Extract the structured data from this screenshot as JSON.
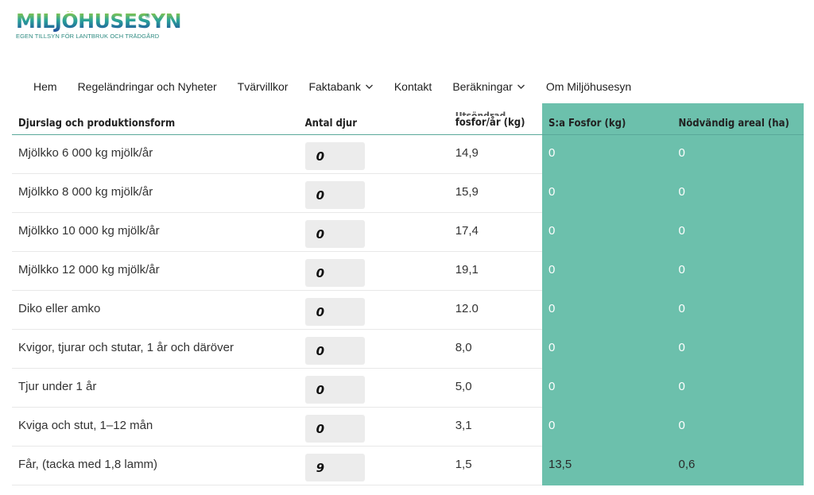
{
  "logo": {
    "title": "MILJÖHUSESYN",
    "reg": "®",
    "subtitle": "EGEN TILLSYN FÖR LANTBRUK OCH TRÄDGÅRD"
  },
  "nav": {
    "items": [
      {
        "label": "Hem",
        "dropdown": false
      },
      {
        "label": "Regeländringar och Nyheter",
        "dropdown": false
      },
      {
        "label": "Tvärvillkor",
        "dropdown": false
      },
      {
        "label": "Faktabank",
        "dropdown": true
      },
      {
        "label": "Kontakt",
        "dropdown": false
      },
      {
        "label": "Beräkningar",
        "dropdown": true
      },
      {
        "label": "Om Miljöhusesyn",
        "dropdown": false
      }
    ]
  },
  "table": {
    "headers": {
      "species": "Djurslag och produktionsform",
      "count": "Antal djur",
      "phosphorus_top": "Utsöndrad",
      "phosphorus": "fosfor/år (kg)",
      "total": "S:a Fosfor (kg)",
      "area": "Nödvändig areal (ha)"
    },
    "rows": [
      {
        "species": "Mjölkko 6 000 kg mjölk/år",
        "count": "0",
        "phosphorus": "14,9",
        "total": "0",
        "area": "0"
      },
      {
        "species": "Mjölkko 8 000 kg mjölk/år",
        "count": "0",
        "phosphorus": "15,9",
        "total": "0",
        "area": "0"
      },
      {
        "species": "Mjölkko 10 000 kg mjölk/år",
        "count": "0",
        "phosphorus": "17,4",
        "total": "0",
        "area": "0"
      },
      {
        "species": "Mjölkko 12 000 kg mjölk/år",
        "count": "0",
        "phosphorus": "19,1",
        "total": "0",
        "area": "0"
      },
      {
        "species": "Diko eller amko",
        "count": "0",
        "phosphorus": "12.0",
        "total": "0",
        "area": "0"
      },
      {
        "species": "Kvigor, tjurar och stutar, 1 år och däröver",
        "count": "0",
        "phosphorus": "8,0",
        "total": "0",
        "area": "0"
      },
      {
        "species": "Tjur under 1 år",
        "count": "0",
        "phosphorus": "5,0",
        "total": "0",
        "area": "0"
      },
      {
        "species": "Kviga och stut, 1–12 mån",
        "count": "0",
        "phosphorus": "3,1",
        "total": "0",
        "area": "0"
      },
      {
        "species": "Får, (tacka med 1,8 lamm)",
        "count": "9",
        "phosphorus": "1,5",
        "total": "13,5",
        "area": "0,6"
      }
    ]
  },
  "colors": {
    "accent_teal": "#6cc0ac",
    "input_bg": "#ececec"
  }
}
